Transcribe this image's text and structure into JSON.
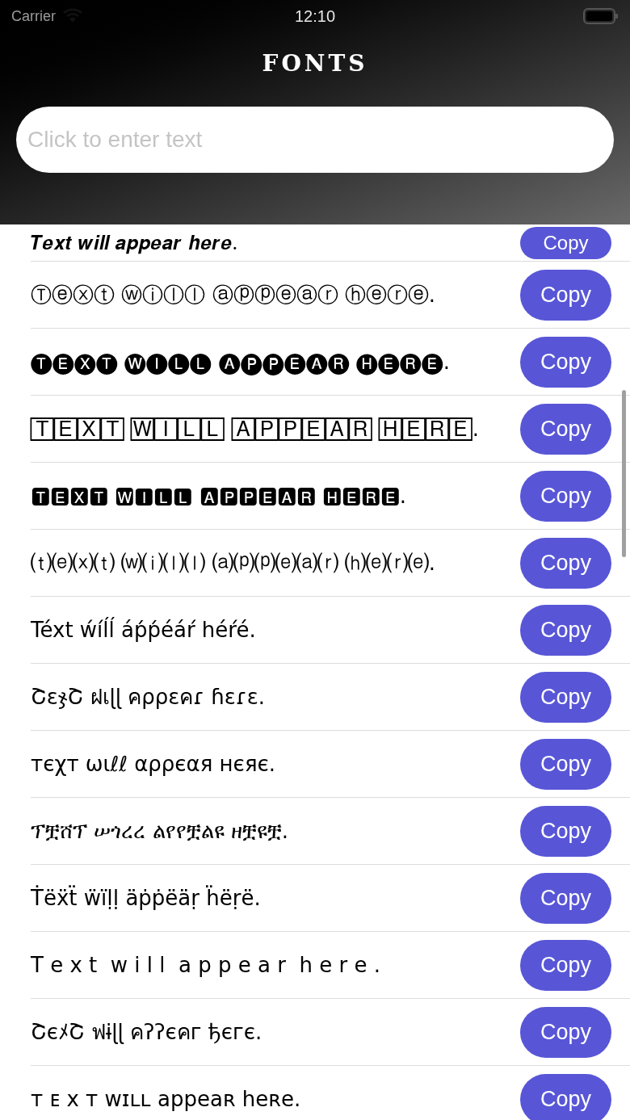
{
  "status_bar": {
    "carrier": "Carrier",
    "time": "12:10"
  },
  "title": "FONTS",
  "search": {
    "placeholder": "Click to enter text"
  },
  "rows": [
    {
      "text": "𝑻𝒆𝒙𝒕 𝒘𝒊𝒍𝒍 𝒂𝒑𝒑𝒆𝒂𝒓 𝒉𝒆𝒓𝒆.",
      "button": "Copy"
    },
    {
      "text": "Ⓣⓔⓧⓣ ⓦⓘⓛⓛ ⓐⓟⓟⓔⓐⓡ ⓗⓔⓡⓔ.",
      "button": "Copy"
    },
    {
      "text": "🅣🅔🅧🅣 🅦🅘🅛🅛 🅐🅟🅟🅔🅐🅡 🅗🅔🅡🅔.",
      "button": "Copy"
    },
    {
      "text": "🅃🄴🅇🅃 🅆🄸🄻🄻 🄰🄿🄿🄴🄰🅁 🄷🄴🅁🄴.",
      "button": "Copy"
    },
    {
      "text": "🆃🅴🆇🆃 🆆🅸🅻🅻 🅰🅿🅿🅴🅰🆁 🅷🅴🆁🅴.",
      "button": "Copy"
    },
    {
      "text": "⒯⒠⒳⒯ ⒲⒤⒧⒧ ⒜⒫⒫⒠⒜⒭ ⒣⒠⒭⒠.",
      "button": "Copy"
    },
    {
      "text": "Téxt ẃíĺĺ áṕṕéáŕ héŕé.",
      "button": "Copy"
    },
    {
      "text": "ՇεჯՇ ฝเɭɭ คρρεคɾ ɦεɾε.",
      "button": "Copy"
    },
    {
      "text": "тєχт ωιℓℓ αρρєαя нєяє.",
      "button": "Copy"
    },
    {
      "text": "ፕቿሸፕ ሠጎረረ ልየየቿልዩ ዘቿዩቿ.",
      "button": "Copy"
    },
    {
      "text": "Ṫëẍẗ ẅïḷḷ äṗṗëäṛ ḧëṛë.",
      "button": "Copy"
    },
    {
      "text": "T e x t  w i l l  a p p e a r  h e r e .",
      "button": "Copy"
    },
    {
      "text": "ՇєﾒՇ ฟɨɭɭ คʔʔєคг ђєгє.",
      "button": "Copy"
    },
    {
      "text": "ᴛ ᴇ x ᴛ ᴡɪʟʟ appeaʀ heʀe.",
      "button": "Copy"
    }
  ]
}
